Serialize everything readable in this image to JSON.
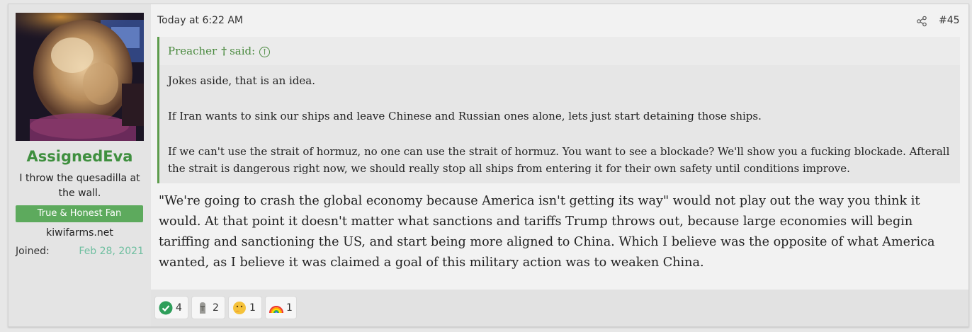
{
  "user": {
    "name": "AssignedEva",
    "title": "I throw the quesadilla at the wall.",
    "banner": "True & Honest Fan",
    "site": "kiwifarms.net",
    "joined_label": "Joined:",
    "joined_value": "Feb 28, 2021"
  },
  "post": {
    "date": "Today at 6:22 AM",
    "number": "#45",
    "share_icon": "share-icon"
  },
  "quote": {
    "author": "Preacher",
    "author_icon": "cross-icon",
    "said": "said:",
    "jump_icon": "arrow-up-circle-icon",
    "paragraphs": [
      "Jokes aside, that is an idea.",
      "If Iran wants to sink our ships and leave Chinese and Russian ones alone, lets just start detaining those ships.",
      "If we can't use the strait of hormuz, no one can use the strait of hormuz. You want to see a blockade? We'll show you a fucking blockade. Afterall the strait is dangerous right now, we should really stop all ships from entering it for their own safety until conditions improve."
    ]
  },
  "message": "\"We're going to crash the global economy because America isn't getting its way\" would not play out the way you think it would. At that point it doesn't matter what sanctions and tariffs Trump throws out, because large economies will begin tariffing and sanctioning the US, and start being more aligned to China. Which I believe was the opposite of what America wanted, as I believe it was claimed a goal of this military action was to weaken China.",
  "reactions": [
    {
      "icon": "checkmark-icon",
      "count": "4"
    },
    {
      "icon": "moai-icon",
      "count": "2"
    },
    {
      "icon": "thinking-face-icon",
      "count": "1"
    },
    {
      "icon": "rainbow-icon",
      "count": "1"
    }
  ],
  "colors": {
    "username": "#3f8f3f",
    "banner": "#5daa5d",
    "quote_border": "#5d9c4c",
    "joined_date": "#6fbfa0"
  }
}
